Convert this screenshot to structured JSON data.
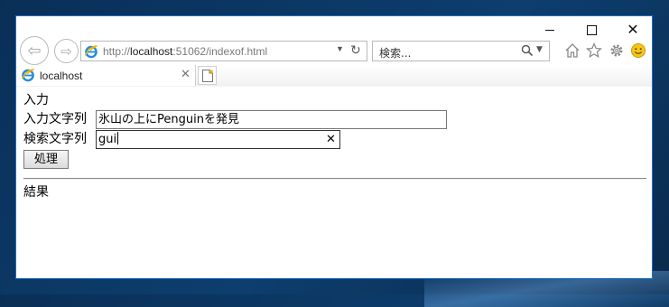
{
  "window": {
    "caption_buttons": [
      "minimize",
      "maximize",
      "close"
    ]
  },
  "toolbar": {
    "address_prefix": "http://",
    "address_host": "localhost",
    "address_rest": ":51062/indexof.html",
    "search_placeholder": "検索...",
    "icons": [
      "back-arrow-icon",
      "forward-arrow-icon",
      "ie-logo-icon",
      "refresh-icon",
      "search-icon",
      "home-icon",
      "star-icon",
      "gear-icon",
      "smiley-icon"
    ]
  },
  "tabs": [
    {
      "title": "localhost",
      "close_glyph": "✕"
    }
  ],
  "glyphs": {
    "back": "⇦",
    "forward": "⇨",
    "dropdown": "▼",
    "refresh": "↻",
    "caption_close": "✕",
    "field_clear": "✕"
  },
  "page": {
    "input_heading": "入力",
    "input_label": "入力文字列",
    "input_value": "氷山の上にPenguinを発見",
    "search_label": "検索文字列",
    "search_value": "gui",
    "process_button": "処理",
    "result_heading": "結果"
  },
  "colors": {
    "window_border": "#1e70c8",
    "ie_logo": "#1e8ae6",
    "desktop": "#0d3e6e"
  }
}
